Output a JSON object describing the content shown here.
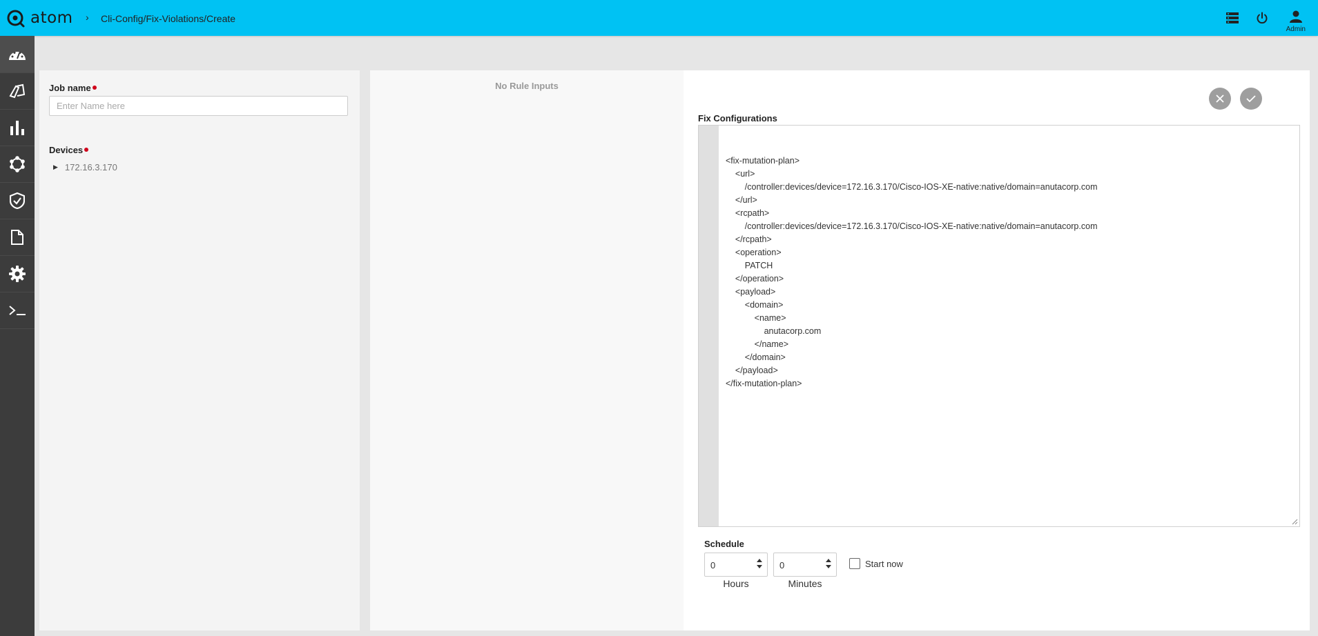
{
  "header": {
    "app_name": "atom",
    "breadcrumb_separator": "›",
    "breadcrumb": "Cli-Config/Fix-Violations/Create",
    "user_label": "Admin",
    "accent_color": "#00c2f3"
  },
  "sidebar": {
    "items": [
      {
        "icon": "dashboard-icon"
      },
      {
        "icon": "resource-manager-icon"
      },
      {
        "icon": "analytics-icon"
      },
      {
        "icon": "topology-icon"
      },
      {
        "icon": "compliance-icon"
      },
      {
        "icon": "document-icon"
      },
      {
        "icon": "settings-icon"
      },
      {
        "icon": "terminal-icon"
      }
    ]
  },
  "form": {
    "job_name_label": "Job name",
    "job_name_placeholder": "Enter Name here",
    "job_name_value": "",
    "devices_label": "Devices",
    "devices": [
      "172.16.3.170"
    ]
  },
  "rules": {
    "empty_text": "No Rule Inputs"
  },
  "fix": {
    "label": "Fix Configurations",
    "code_lines": [
      "<fix-mutation-plan>",
      "    <url>",
      "        /controller:devices/device=172.16.3.170/Cisco-IOS-XE-native:native/domain=anutacorp.com",
      "    </url>",
      "    <rcpath>",
      "        /controller:devices/device=172.16.3.170/Cisco-IOS-XE-native:native/domain=anutacorp.com",
      "    </rcpath>",
      "    <operation>",
      "        PATCH",
      "    </operation>",
      "    <payload>",
      "        <domain>",
      "            <name>",
      "                anutacorp.com",
      "            </name>",
      "        </domain>",
      "    </payload>",
      "</fix-mutation-plan>"
    ]
  },
  "schedule": {
    "label": "Schedule",
    "hours_value": "0",
    "hours_label": "Hours",
    "minutes_value": "0",
    "minutes_label": "Minutes",
    "start_now_label": "Start now",
    "start_now_checked": false
  }
}
